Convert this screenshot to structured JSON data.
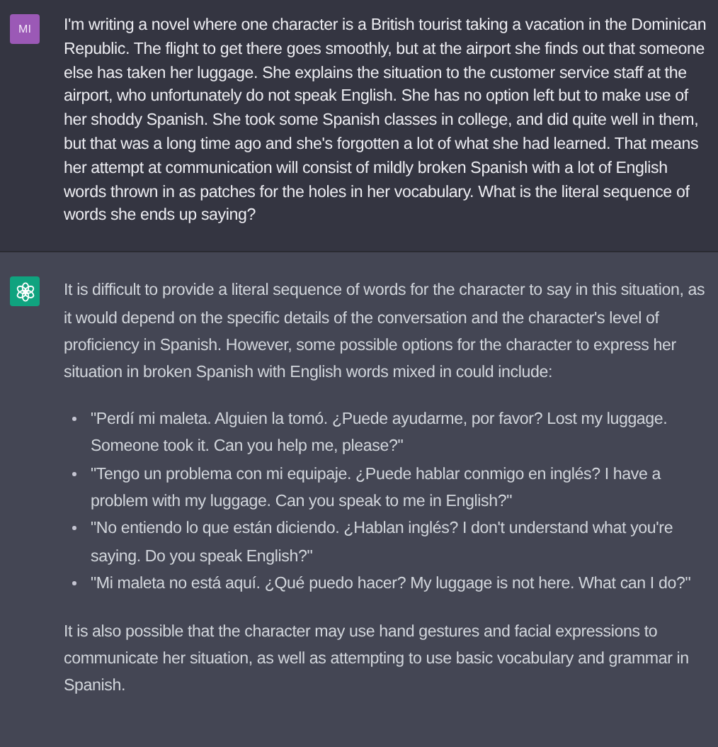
{
  "messages": [
    {
      "kind": "user",
      "avatar": "MI",
      "blocks": [
        {
          "kind": "paragraph",
          "text": "I'm writing a novel where one character is a British tourist taking a vacation in the Dominican Republic. The flight to get there goes smoothly, but at the airport she finds out that someone else has taken her luggage. She explains the situation to the customer service staff at the airport, who unfortunately do not speak English. She has no option left but to make use of her shoddy Spanish. She took some Spanish classes in college, and did quite well in them, but that was a long time ago and she's forgotten a lot of what she had learned. That means her attempt at communication will consist of mildly broken Spanish with a lot of English words thrown in as patches for the holes in her vocabulary. What is the literal sequence of words she ends up saying?"
        }
      ]
    },
    {
      "kind": "assistant",
      "blocks": [
        {
          "kind": "paragraph",
          "text": "It is difficult to provide a literal sequence of words for the character to say in this situation, as it would depend on the specific details of the conversation and the character's level of proficiency in Spanish. However, some possible options for the character to express her situation in broken Spanish with English words mixed in could include:"
        },
        {
          "kind": "list",
          "items": [
            "\"Perdí mi maleta. Alguien la tomó. ¿Puede ayudarme, por favor? Lost my luggage. Someone took it. Can you help me, please?\"",
            "\"Tengo un problema con mi equipaje. ¿Puede hablar conmigo en inglés? I have a problem with my luggage. Can you speak to me in English?\"",
            "\"No entiendo lo que están diciendo. ¿Hablan inglés? I don't understand what you're saying. Do you speak English?\"",
            "\"Mi maleta no está aquí. ¿Qué puedo hacer? My luggage is not here. What can I do?\""
          ]
        },
        {
          "kind": "paragraph",
          "text": "It is also possible that the character may use hand gestures and facial expressions to communicate her situation, as well as attempting to use basic vocabulary and grammar in Spanish."
        }
      ]
    }
  ]
}
